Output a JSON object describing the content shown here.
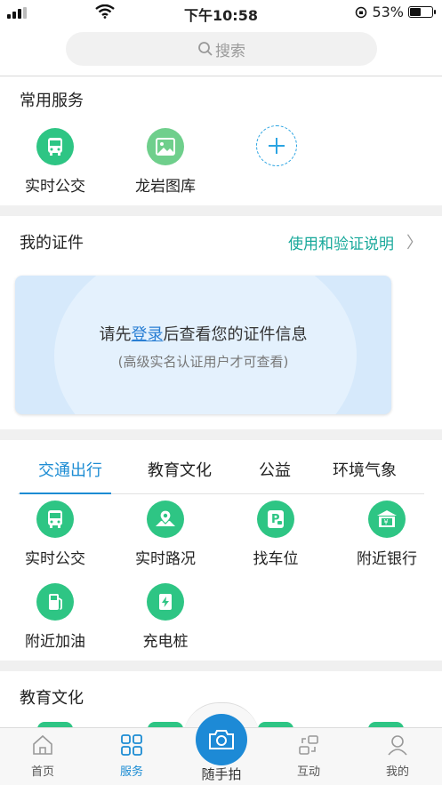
{
  "status": {
    "time": "下午10:58",
    "battery": "53%",
    "battery_level": 0.53
  },
  "search": {
    "placeholder": "搜索"
  },
  "common_services": {
    "title": "常用服务",
    "items": [
      {
        "label": "实时公交",
        "icon": "bus-icon"
      },
      {
        "label": "龙岩图库",
        "icon": "picture-icon"
      }
    ],
    "add_icon": "plus-icon"
  },
  "certificates": {
    "title": "我的证件",
    "link_label": "使用和验证说明",
    "prompt_before": "请先",
    "prompt_login": "登录",
    "prompt_after": "后查看您的证件信息",
    "note": "(高级实名认证用户才可查看)"
  },
  "category_tabs": [
    "交通出行",
    "教育文化",
    "公益",
    "环境气象"
  ],
  "traffic_items": [
    {
      "label": "实时公交",
      "icon": "bus-icon"
    },
    {
      "label": "实时路况",
      "icon": "map-pin-icon"
    },
    {
      "label": "找车位",
      "icon": "parking-icon"
    },
    {
      "label": "附近银行",
      "icon": "bank-icon"
    },
    {
      "label": "附近加油",
      "icon": "gas-pump-icon"
    },
    {
      "label": "充电桩",
      "icon": "charging-icon"
    }
  ],
  "education_section": {
    "title": "教育文化"
  },
  "bottom_nav": {
    "home": "首页",
    "services": "服务",
    "camera": "随手拍",
    "interact": "互动",
    "mine": "我的"
  },
  "colors": {
    "accent_blue": "#1c8cd3",
    "green": "#2ec584",
    "teal_link": "#17a89a"
  }
}
